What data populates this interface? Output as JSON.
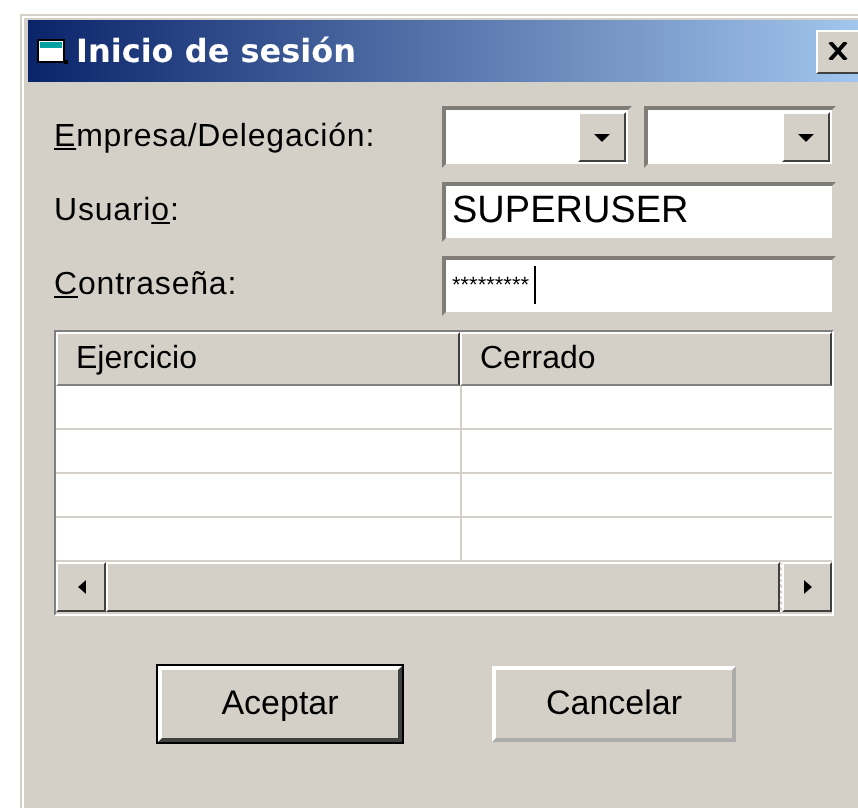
{
  "window": {
    "title": "Inicio de sesión"
  },
  "fields": [
    {
      "kind": "combos",
      "label": [
        {
          "text": "E",
          "underline": true
        },
        {
          "text": "mpresa/Delegación:",
          "underline": false
        }
      ]
    },
    {
      "kind": "text",
      "label": [
        {
          "text": "Usuari",
          "underline": false
        },
        {
          "text": "o",
          "underline": true
        },
        {
          "text": ":",
          "underline": false
        }
      ],
      "value": "SUPERUSER",
      "focused": false
    },
    {
      "kind": "password",
      "label": [
        {
          "text": "C",
          "underline": true
        },
        {
          "text": "ontraseña:",
          "underline": false
        }
      ],
      "value": "*********",
      "focused": true
    }
  ],
  "table": {
    "columns": [
      "Ejercicio",
      "Cerrado"
    ],
    "rows": [
      {
        "selected": false
      },
      {
        "selected": false
      },
      {
        "selected": false
      },
      {
        "selected": false
      }
    ]
  },
  "buttons": [
    {
      "label": "Aceptar",
      "default": true
    },
    {
      "label": "Cancelar",
      "default": false
    }
  ]
}
